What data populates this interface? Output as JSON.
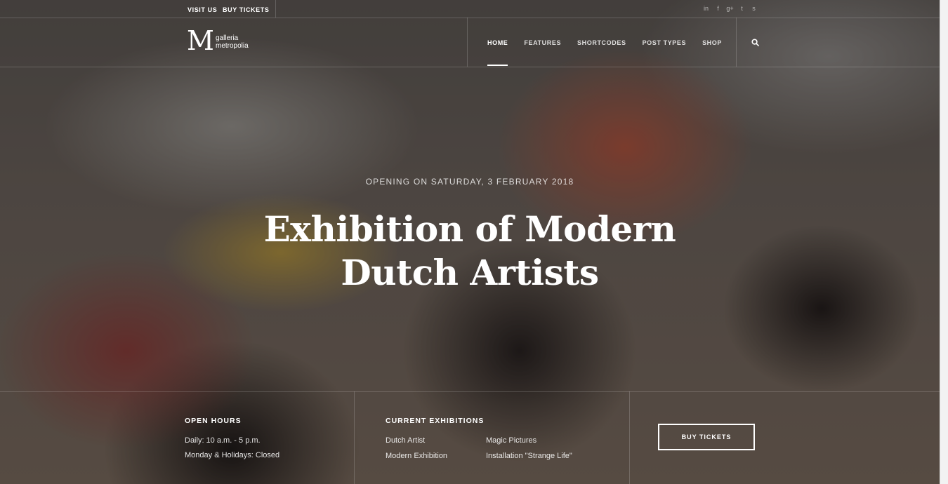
{
  "topbar": {
    "links": [
      "VISIT US",
      "BUY TICKETS"
    ],
    "social": [
      "in",
      "f",
      "g+",
      "t",
      "s"
    ]
  },
  "brand": {
    "mark": "M",
    "line1": "galleria",
    "line2": "metropolia"
  },
  "nav": {
    "items": [
      "HOME",
      "FEATURES",
      "SHORTCODES",
      "POST TYPES",
      "SHOP"
    ],
    "active": "HOME"
  },
  "icons": {
    "search": "search-icon"
  },
  "hero": {
    "subtitle": "OPENING ON SATURDAY, 3 FEBRUARY 2018",
    "title_line1": "Exhibition of Modern",
    "title_line2": "Dutch Artists"
  },
  "info": {
    "hours": {
      "title": "OPEN HOURS",
      "lines": [
        "Daily: 10 a.m. - 5 p.m.",
        "Monday & Holidays: Closed"
      ]
    },
    "exhibitions": {
      "title": "CURRENT EXHIBITIONS",
      "items": [
        "Dutch Artist",
        "Modern Exhibition",
        "Magic Pictures",
        "Installation \"Strange Life\""
      ]
    },
    "cta": "BUY TICKETS"
  },
  "colors": {
    "text": "#ffffff",
    "overlay": "#1c1a1a"
  }
}
